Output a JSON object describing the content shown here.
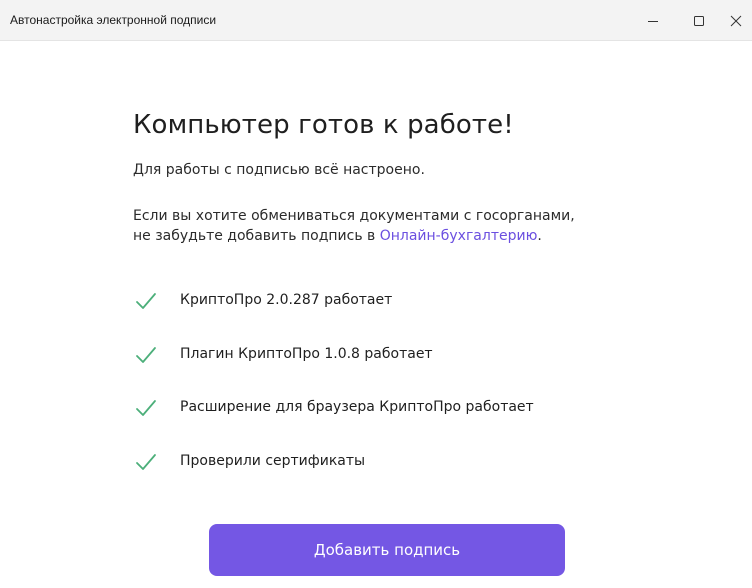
{
  "window": {
    "title": "Автонастройка электронной подписи"
  },
  "main": {
    "heading": "Компьютер готов к работе!",
    "status_text": "Для работы с подписью всё настроено.",
    "info_line1": "Если вы хотите обмениваться документами с госорганами,",
    "info_line2_prefix": "не забудьте добавить подпись в ",
    "info_link": "Онлайн-бухгалтерию",
    "info_line2_suffix": ".",
    "checks": [
      {
        "label": "КриптоПро 2.0.287 работает",
        "icon": "check-icon"
      },
      {
        "label": "Плагин КриптоПро 1.0.8 работает",
        "icon": "check-icon"
      },
      {
        "label": "Расширение для браузера КриптоПро работает",
        "icon": "check-icon"
      },
      {
        "label": "Проверили сертификаты",
        "icon": "check-icon"
      }
    ],
    "primary_button": "Добавить подпись"
  },
  "colors": {
    "accent": "#7457e4",
    "link": "#6b4fe0",
    "check": "#4caf7a",
    "titlebar": "#f3f3f3"
  }
}
